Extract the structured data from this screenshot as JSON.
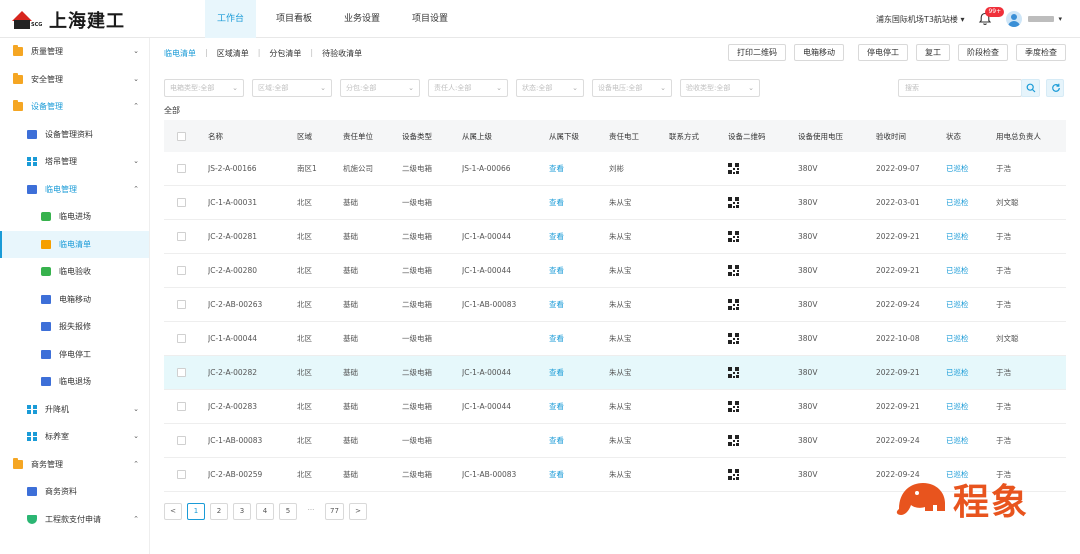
{
  "app": {
    "logo_text": "上海建工",
    "logo_sub": "SCG"
  },
  "nav": [
    {
      "label": "工作台",
      "active": true
    },
    {
      "label": "项目看板"
    },
    {
      "label": "业务设置"
    },
    {
      "label": "项目设置"
    }
  ],
  "header": {
    "site": "浦东国际机场T3航站楼",
    "badge": "99+"
  },
  "sidebar": [
    {
      "label": "质量管理",
      "level": 1,
      "icon": "folder-icon",
      "chevron": "⌄"
    },
    {
      "label": "安全管理",
      "level": 1,
      "icon": "folder-icon",
      "chevron": "⌄"
    },
    {
      "label": "设备管理",
      "level": 1,
      "icon": "folder-icon",
      "chevron": "⌃",
      "open": true
    },
    {
      "label": "设备管理资料",
      "level": 2,
      "icon": "document-icon"
    },
    {
      "label": "塔吊管理",
      "level": 2,
      "icon": "crane-icon",
      "chevron": "⌄"
    },
    {
      "label": "临电管理",
      "level": 2,
      "icon": "power-icon",
      "chevron": "⌃",
      "open": true
    },
    {
      "label": "临电进场",
      "level": 3,
      "icon": "entry-icon"
    },
    {
      "label": "临电清单",
      "level": 3,
      "icon": "list-icon",
      "active": true
    },
    {
      "label": "临电验收",
      "level": 3,
      "icon": "checklist-icon"
    },
    {
      "label": "电箱移动",
      "level": 3,
      "icon": "move-icon"
    },
    {
      "label": "报失报修",
      "level": 3,
      "icon": "repair-icon"
    },
    {
      "label": "停电停工",
      "level": 3,
      "icon": "stop-icon"
    },
    {
      "label": "临电退场",
      "level": 3,
      "icon": "exit-icon"
    },
    {
      "label": "升降机",
      "level": 2,
      "icon": "elevator-icon",
      "chevron": "⌄"
    },
    {
      "label": "标养室",
      "level": 2,
      "icon": "room-icon",
      "chevron": "⌄"
    },
    {
      "label": "商务管理",
      "level": 1,
      "icon": "folder-icon",
      "chevron": "⌃"
    },
    {
      "label": "商务资料",
      "level": 2,
      "icon": "document-icon"
    },
    {
      "label": "工程款支付申请",
      "level": 2,
      "icon": "shield-icon",
      "chevron": "⌃"
    }
  ],
  "subtabs": [
    {
      "label": "临电清单",
      "active": true
    },
    {
      "label": "区域清单"
    },
    {
      "label": "分包清单"
    },
    {
      "label": "待验收清单"
    }
  ],
  "actions": [
    "打印二维码",
    "电箱移动",
    "停电停工",
    "复工",
    "阶段检查",
    "季度检查"
  ],
  "filters": [
    {
      "placeholder": "电箱类型:全部",
      "width": 80
    },
    {
      "placeholder": "区域:全部",
      "width": 80
    },
    {
      "placeholder": "分包:全部",
      "width": 80
    },
    {
      "placeholder": "责任人:全部",
      "width": 80
    },
    {
      "placeholder": "状态:全部",
      "width": 68
    },
    {
      "placeholder": "设备电压:全部",
      "width": 80
    },
    {
      "placeholder": "验收类型:全部",
      "width": 80
    }
  ],
  "search": {
    "placeholder": "搜索"
  },
  "all_label": "全部",
  "table": {
    "columns": [
      "名称",
      "区域",
      "责任单位",
      "设备类型",
      "从属上级",
      "从属下级",
      "责任电工",
      "联系方式",
      "设备二维码",
      "设备使用电压",
      "验收时间",
      "状态",
      "用电总负责人"
    ],
    "rows": [
      {
        "name": "JS-2-A-00166",
        "area": "南区1",
        "unit": "机施公司",
        "type": "二级电箱",
        "up": "JS-1-A-00066",
        "down": "查看",
        "elec": "刘彬",
        "contact": "",
        "volt": "380V",
        "date": "2022-09-07",
        "status": "已巡检",
        "owner": "于浩"
      },
      {
        "name": "JC-1-A-00031",
        "area": "北区",
        "unit": "基础",
        "type": "一级电箱",
        "up": "",
        "down": "查看",
        "elec": "朱从宝",
        "contact": "",
        "volt": "380V",
        "date": "2022-03-01",
        "status": "已巡检",
        "owner": "刘文聪"
      },
      {
        "name": "JC-2-A-00281",
        "area": "北区",
        "unit": "基础",
        "type": "二级电箱",
        "up": "JC-1-A-00044",
        "down": "查看",
        "elec": "朱从宝",
        "contact": "",
        "volt": "380V",
        "date": "2022-09-21",
        "status": "已巡检",
        "owner": "于浩"
      },
      {
        "name": "JC-2-A-00280",
        "area": "北区",
        "unit": "基础",
        "type": "二级电箱",
        "up": "JC-1-A-00044",
        "down": "查看",
        "elec": "朱从宝",
        "contact": "",
        "volt": "380V",
        "date": "2022-09-21",
        "status": "已巡检",
        "owner": "于浩"
      },
      {
        "name": "JC-2-AB-00263",
        "area": "北区",
        "unit": "基础",
        "type": "二级电箱",
        "up": "JC-1-AB-00083",
        "down": "查看",
        "elec": "朱从宝",
        "contact": "",
        "volt": "380V",
        "date": "2022-09-24",
        "status": "已巡检",
        "owner": "于浩"
      },
      {
        "name": "JC-1-A-00044",
        "area": "北区",
        "unit": "基础",
        "type": "一级电箱",
        "up": "",
        "down": "查看",
        "elec": "朱从宝",
        "contact": "",
        "volt": "380V",
        "date": "2022-10-08",
        "status": "已巡检",
        "owner": "刘文聪"
      },
      {
        "name": "JC-2-A-00282",
        "area": "北区",
        "unit": "基础",
        "type": "二级电箱",
        "up": "JC-1-A-00044",
        "down": "查看",
        "elec": "朱从宝",
        "contact": "",
        "volt": "380V",
        "date": "2022-09-21",
        "status": "已巡检",
        "owner": "于浩",
        "highlight": true
      },
      {
        "name": "JC-2-A-00283",
        "area": "北区",
        "unit": "基础",
        "type": "二级电箱",
        "up": "JC-1-A-00044",
        "down": "查看",
        "elec": "朱从宝",
        "contact": "",
        "volt": "380V",
        "date": "2022-09-21",
        "status": "已巡检",
        "owner": "于浩"
      },
      {
        "name": "JC-1-AB-00083",
        "area": "北区",
        "unit": "基础",
        "type": "一级电箱",
        "up": "",
        "down": "查看",
        "elec": "朱从宝",
        "contact": "",
        "volt": "380V",
        "date": "2022-09-24",
        "status": "已巡检",
        "owner": "于浩"
      },
      {
        "name": "JC-2-AB-00259",
        "area": "北区",
        "unit": "基础",
        "type": "二级电箱",
        "up": "JC-1-AB-00083",
        "down": "查看",
        "elec": "朱从宝",
        "contact": "",
        "volt": "380V",
        "date": "2022-09-24",
        "status": "已巡检",
        "owner": "于浩"
      }
    ]
  },
  "pagination": {
    "prev": "<",
    "pages": [
      "1",
      "2",
      "3",
      "4",
      "5"
    ],
    "ellipsis": "···",
    "last": "77",
    "next": ">",
    "current": "1"
  },
  "watermark": {
    "text": "程象"
  },
  "colors": {
    "accent": "#1a9bd7",
    "brand_red": "#d7261e",
    "watermark": "#e8541e"
  }
}
